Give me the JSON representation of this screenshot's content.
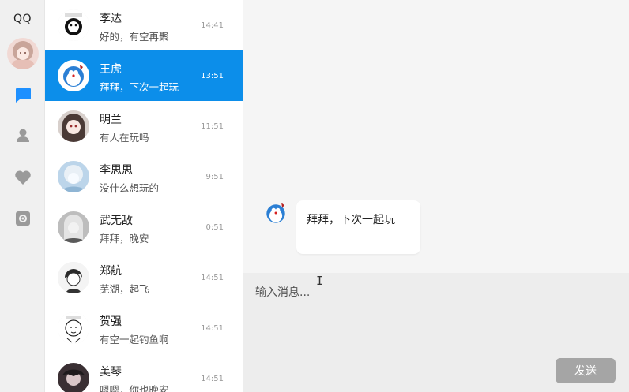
{
  "app": {
    "title": "QQ"
  },
  "rail": {
    "icons": [
      "chat-icon",
      "contacts-icon",
      "favorites-icon",
      "settings-icon"
    ],
    "active": "chat-icon",
    "accent": "#1e90ff",
    "inactive": "#9a9a9a"
  },
  "conversations": [
    {
      "name": "李达",
      "message": "好的，有空再聚",
      "time": "14:41"
    },
    {
      "name": "王虎",
      "message": "拜拜，下次一起玩",
      "time": "13:51",
      "active": true
    },
    {
      "name": "明兰",
      "message": "有人在玩吗",
      "time": "11:51"
    },
    {
      "name": "李思思",
      "message": "没什么想玩的",
      "time": "9:51"
    },
    {
      "name": "武无敌",
      "message": "拜拜，晚安",
      "time": "0:51"
    },
    {
      "name": "郑航",
      "message": "芜湖，起飞",
      "time": "14:51"
    },
    {
      "name": "贺强",
      "message": "有空一起钓鱼啊",
      "time": "14:51"
    },
    {
      "name": "美琴",
      "message": "嗯嗯，你也晚安",
      "time": "14:51"
    }
  ],
  "chat": {
    "messages": [
      {
        "text": "拜拜，下次一起玩"
      }
    ]
  },
  "composer": {
    "placeholder": "输入消息...",
    "value": "",
    "send_label": "发送"
  },
  "colors": {
    "selected_row": "#0c8eea",
    "send_button": "#a5a5a5"
  }
}
